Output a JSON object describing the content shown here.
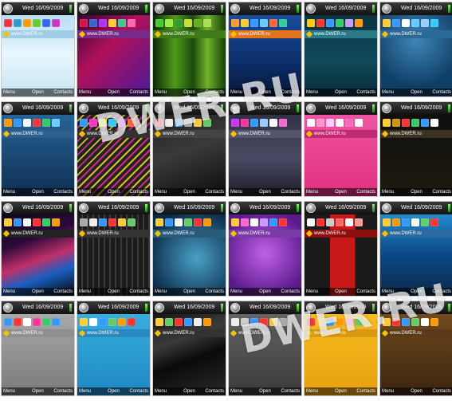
{
  "statusbar": {
    "date": "Wed 16/09/2009"
  },
  "address": "www.DWER.ru",
  "softkeys": {
    "left": "Menu",
    "middle": "Open",
    "right": "Contacts"
  },
  "watermark": "DWER.RU",
  "themes": [
    {
      "wall": "linear-gradient(#a9d6ef,#e8f6fd 55%,#c7e4f1)",
      "accent": "#9fcde6",
      "icons": [
        "#e34",
        "#39c",
        "#f90",
        "#6c3",
        "#36f",
        "#c3c"
      ]
    },
    {
      "wall": "linear-gradient(135deg,#1a0030,#b0105a 45%,#4b1a9a)",
      "accent": "#7a2a8a",
      "icons": [
        "#d14",
        "#36c",
        "#a3f",
        "#fc3",
        "#3c9",
        "#f6a"
      ]
    },
    {
      "wall": "linear-gradient(90deg,#0a2a05,#4f9a1a 30%,#1d4a0b 55%,#6fb42a 75%,#183d08)",
      "accent": "#3f7a18",
      "icons": [
        "#4c3",
        "#9e4",
        "#393",
        "#cd3",
        "#6a2",
        "#ad5"
      ]
    },
    {
      "wall": "linear-gradient(#1b55a8,#0b2a63 70%,#061633)",
      "accent": "#e4741b",
      "icons": [
        "#f93",
        "#fc3",
        "#39f",
        "#6cf",
        "#f63",
        "#3c9"
      ]
    },
    {
      "wall": "linear-gradient(#0a2a3a,#0e4a5a 60%,#0a2a3a)",
      "accent": "#2a7a88",
      "icons": [
        "#fc0",
        "#f33",
        "#39f",
        "#3c6",
        "#c9f",
        "#f90"
      ]
    },
    {
      "wall": "radial-gradient(circle at 50% 40%,#3f86b8,#0f3e66 70%)",
      "accent": "#2a6a98",
      "icons": [
        "#fc3",
        "#39f",
        "#fff",
        "#6cf",
        "#9cf",
        "#3cf"
      ]
    },
    {
      "wall": "linear-gradient(#2c6ba0,#0d2f52)",
      "accent": "#2d5f8c",
      "icons": [
        "#f90",
        "#39f",
        "#fff",
        "#f33",
        "#3c6",
        "#6cf"
      ]
    },
    {
      "wall": "repeating-linear-gradient(135deg,#222 0 4px,#d8c20a 4px 6px,#222 6px 10px,#cf2a8a 10px 12px)",
      "accent": "#333",
      "icons": [
        "#39f",
        "#f3c",
        "#ff3",
        "#3cf",
        "#c3f",
        "#f63"
      ]
    },
    {
      "wall": "linear-gradient(160deg,#1a1a1a,#3a3a3a 50%,#0c0c0c)",
      "accent": "#444",
      "icons": [
        "#f33",
        "#eee",
        "#39f",
        "#aaa",
        "#fc3",
        "#6c6"
      ]
    },
    {
      "wall": "linear-gradient(#2a2a3c,#4a4a64 60%,#1c1c28)",
      "accent": "#555570",
      "icons": [
        "#c3f",
        "#f39",
        "#39f",
        "#9cf",
        "#fff",
        "#f6c"
      ]
    },
    {
      "wall": "linear-gradient(#f05aa8,#e0307f)",
      "accent": "#c02a70",
      "icons": [
        "#fff",
        "#f9c",
        "#fcf",
        "#fff",
        "#f6b",
        "#fff"
      ]
    },
    {
      "wall": "linear-gradient(#0d0d0d,#1e1a10)",
      "accent": "#3a3220",
      "icons": [
        "#fc3",
        "#c90",
        "#f33",
        "#3c6",
        "#39f",
        "#fff"
      ]
    },
    {
      "wall": "linear-gradient(160deg,#05050a,#2a0a3a 40%,#c0306a 60%,#1a5fc0 75%,#05050a)",
      "accent": "#222",
      "icons": [
        "#fc3",
        "#39f",
        "#fff",
        "#f33",
        "#3c6",
        "#f90"
      ]
    },
    {
      "wall": "repeating-linear-gradient(90deg,#1a1a1a 0 5px,#3a3a3a 5px 7px)",
      "accent": "#333",
      "icons": [
        "#aaa",
        "#eee",
        "#39f",
        "#f33",
        "#fc3",
        "#6c6"
      ]
    },
    {
      "wall": "radial-gradient(circle at 60% 60%,#4aa0c8,#0a2a48 70%)",
      "accent": "#2a5a7a",
      "icons": [
        "#fc3",
        "#39f",
        "#fff",
        "#6c6",
        "#f33",
        "#f90"
      ]
    },
    {
      "wall": "radial-gradient(circle at 50% 55%,#c060e8,#5a1a8a 70%)",
      "accent": "#7a3aa8",
      "icons": [
        "#fc3",
        "#f6c",
        "#fff",
        "#c9f",
        "#39f",
        "#f33"
      ]
    },
    {
      "wall": "linear-gradient(90deg,#1a1a1a 0 35%,#c81818 35% 70%,#1a1a1a 70%)",
      "accent": "#8a1010",
      "icons": [
        "#fff",
        "#f33",
        "#ccc",
        "#f66",
        "#fff",
        "#f99"
      ]
    },
    {
      "wall": "linear-gradient(#2aa0e0,#0a4a8a 55%,#0a2a4a)",
      "accent": "#2a6aa0",
      "icons": [
        "#fc3",
        "#f90",
        "#39f",
        "#fff",
        "#6c6",
        "#f33"
      ]
    },
    {
      "wall": "linear-gradient(#b0b0b0,#7a7a7a)",
      "accent": "#909090",
      "icons": [
        "#39f",
        "#f33",
        "#fff",
        "#f39",
        "#3c6",
        "#39f"
      ]
    },
    {
      "wall": "linear-gradient(#3ab4e0,#1e88c4)",
      "accent": "#2a8ac0",
      "icons": [
        "#fc3",
        "#fff",
        "#39f",
        "#6c6",
        "#f90",
        "#f33"
      ]
    },
    {
      "wall": "linear-gradient(160deg,#0a0a0a,#3a3a3a 40%,#0a0a0a 60%,#2a2a2a)",
      "accent": "#333",
      "icons": [
        "#fc3",
        "#6c6",
        "#f33",
        "#39f",
        "#eee",
        "#f90"
      ]
    },
    {
      "wall": "linear-gradient(#6a6a6a,#3a3a3a)",
      "accent": "#555",
      "icons": [
        "#eee",
        "#ccc",
        "#39f",
        "#f33",
        "#fc3",
        "#aaa"
      ]
    },
    {
      "wall": "linear-gradient(#f8c020,#e8a010)",
      "accent": "#d89a10",
      "icons": [
        "#f33",
        "#fc3",
        "#39f",
        "#f90",
        "#f6c",
        "#6c6"
      ]
    },
    {
      "wall": "linear-gradient(#7a5020,#3a2410)",
      "accent": "#5a3a18",
      "icons": [
        "#fc3",
        "#f33",
        "#39f",
        "#6c6",
        "#fff",
        "#f90"
      ]
    }
  ]
}
